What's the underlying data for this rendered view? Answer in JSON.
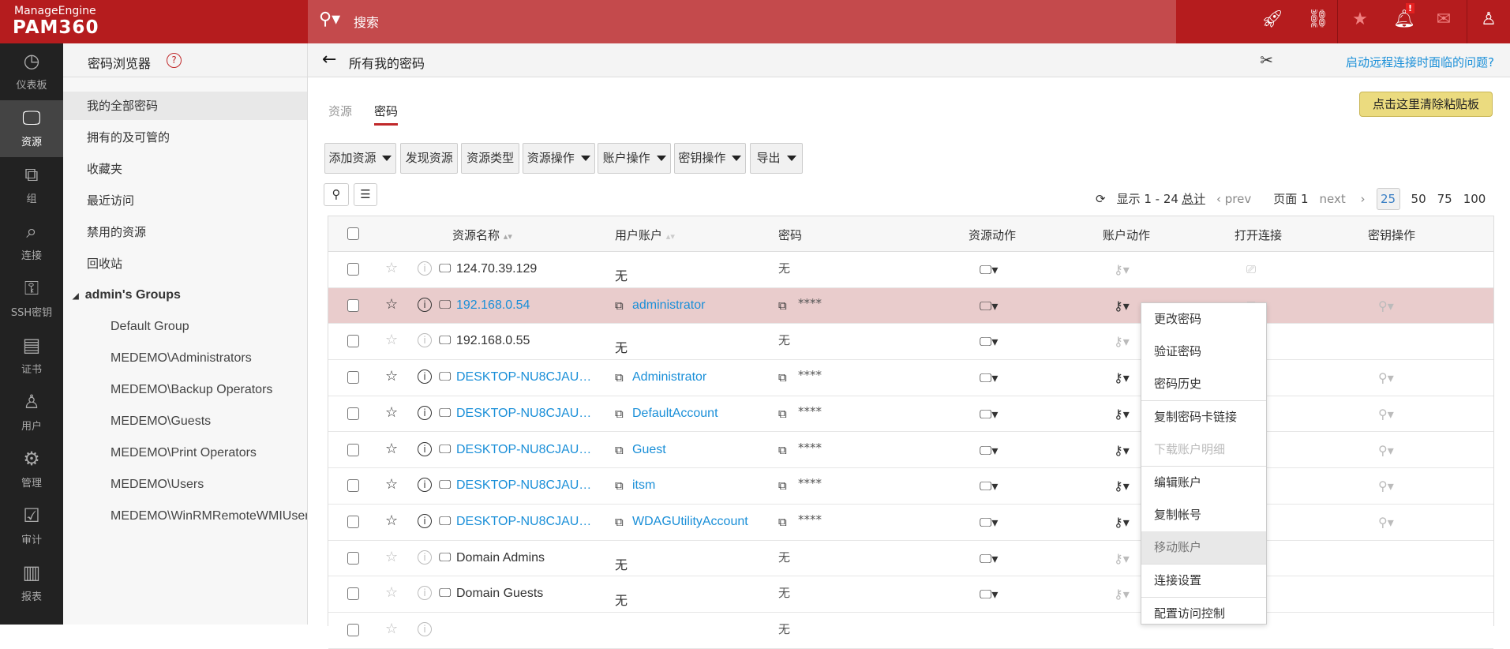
{
  "brand": {
    "company": "ManageEngine",
    "product": "PAM360"
  },
  "search": {
    "placeholder": "搜索"
  },
  "topicons": [
    "rocket-icon",
    "link-icon",
    "user-star-icon",
    "bell-icon",
    "mail-icon",
    "user-icon"
  ],
  "nav": [
    {
      "label": "仪表板",
      "icon": "◷"
    },
    {
      "label": "资源",
      "icon": "🖵"
    },
    {
      "label": "组",
      "icon": "⧉"
    },
    {
      "label": "连接",
      "icon": "⌕"
    },
    {
      "label": "SSH密钥",
      "icon": "⚿"
    },
    {
      "label": "证书",
      "icon": "▤"
    },
    {
      "label": "用户",
      "icon": "♙"
    },
    {
      "label": "管理",
      "icon": "⚙"
    },
    {
      "label": "审计",
      "icon": "☑"
    },
    {
      "label": "报表",
      "icon": "▥"
    }
  ],
  "sidebar": {
    "title": "密码浏览器",
    "help": "?",
    "items": [
      "我的全部密码",
      "拥有的及可管的",
      "收藏夹",
      "最近访问",
      "禁用的资源",
      "回收站"
    ],
    "group": "admin's Groups",
    "groups": [
      "Default Group",
      "MEDEMO\\Administrators",
      "MEDEMO\\Backup Operators",
      "MEDEMO\\Guests",
      "MEDEMO\\Print Operators",
      "MEDEMO\\Users",
      "MEDEMO\\WinRMRemoteWMIUsers"
    ]
  },
  "main": {
    "title": "所有我的密码",
    "help_link": "启动远程连接时面临的问题?",
    "tabs": [
      "资源",
      "密码"
    ],
    "clear_clipboard": "点击这里清除粘贴板",
    "toolbar": [
      {
        "label": "添加资源",
        "caret": true
      },
      {
        "label": "发现资源",
        "caret": false
      },
      {
        "label": "资源类型",
        "caret": false
      },
      {
        "label": "资源操作",
        "caret": true
      },
      {
        "label": "账户操作",
        "caret": true
      },
      {
        "label": "密钥操作",
        "caret": true
      },
      {
        "label": "导出",
        "caret": true
      }
    ],
    "pager": {
      "showing": "显示 1 - 24",
      "total": "总计",
      "prev": "prev",
      "page": "页面 1",
      "next": "next",
      "sizes": [
        "25",
        "50",
        "75",
        "100"
      ]
    },
    "columns": [
      "资源名称",
      "用户账户",
      "密码",
      "资源动作",
      "账户动作",
      "打开连接",
      "密钥操作"
    ],
    "rows": [
      {
        "resource": "124.70.39.129",
        "account": "无",
        "password": "无",
        "link": false,
        "conn": true,
        "key": false
      },
      {
        "resource": "192.168.0.54",
        "account": "administrator",
        "password": "****",
        "link": true,
        "conn": true,
        "key": true
      },
      {
        "resource": "192.168.0.55",
        "account": "无",
        "password": "无",
        "link": false,
        "conn": false,
        "key": false
      },
      {
        "resource": "DESKTOP-NU8CJAU…",
        "account": "Administrator",
        "password": "****",
        "link": true,
        "conn": false,
        "key": true
      },
      {
        "resource": "DESKTOP-NU8CJAU…",
        "account": "DefaultAccount",
        "password": "****",
        "link": true,
        "conn": false,
        "key": true
      },
      {
        "resource": "DESKTOP-NU8CJAU…",
        "account": "Guest",
        "password": "****",
        "link": true,
        "conn": false,
        "key": true
      },
      {
        "resource": "DESKTOP-NU8CJAU…",
        "account": "itsm",
        "password": "****",
        "link": true,
        "conn": false,
        "key": true
      },
      {
        "resource": "DESKTOP-NU8CJAU…",
        "account": "WDAGUtilityAccount",
        "password": "****",
        "link": true,
        "conn": false,
        "key": true
      },
      {
        "resource": "Domain Admins",
        "account": "无",
        "password": "无",
        "link": false,
        "conn": false,
        "key": false
      },
      {
        "resource": "Domain Guests",
        "account": "无",
        "password": "无",
        "link": false,
        "conn": false,
        "key": false
      },
      {
        "resource": "",
        "account": "",
        "password": "无",
        "link": false,
        "conn": false,
        "key": false
      }
    ],
    "menu": [
      {
        "label": "更改密码"
      },
      {
        "label": "验证密码"
      },
      {
        "label": "密码历史",
        "sep": true
      },
      {
        "label": "复制密码卡链接"
      },
      {
        "label": "下载账户明细",
        "disabled": true,
        "sep": true
      },
      {
        "label": "编辑账户"
      },
      {
        "label": "复制帐号"
      },
      {
        "label": "移动账户",
        "hover": true,
        "sep": true
      },
      {
        "label": "连接设置",
        "sep": true
      },
      {
        "label": "配置访问控制"
      }
    ]
  }
}
